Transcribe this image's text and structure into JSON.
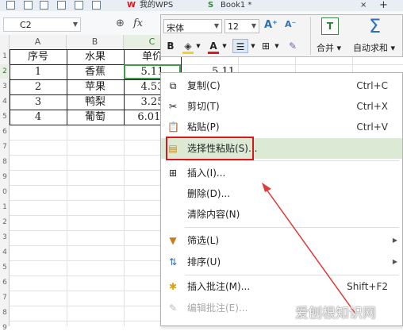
{
  "tabs": {
    "wps": "我的WPS",
    "book": "Book1 *"
  },
  "name_box": {
    "value": "C2"
  },
  "formula": {
    "fx_label": "fx"
  },
  "mini_toolbar": {
    "font": "宋体",
    "size": "12",
    "bold": "B",
    "font_color_letter": "A",
    "merge_label": "合并",
    "autosum_label": "自动求和",
    "merge_icon_letter": "T",
    "sum_symbol": "Σ"
  },
  "columns": [
    "A",
    "B",
    "C"
  ],
  "rows": [
    "1",
    "2",
    "3",
    "4",
    "5",
    "6",
    "7",
    "8",
    "9",
    "0",
    "1",
    "2",
    "3",
    "4",
    "5",
    "6",
    "7",
    "8",
    "9"
  ],
  "table": {
    "headers": [
      "序号",
      "水果",
      "单价"
    ],
    "rows": [
      [
        "1",
        "香蕉",
        "5.11"
      ],
      [
        "2",
        "苹果",
        "4.53"
      ],
      [
        "3",
        "鸭梨",
        "3.25"
      ],
      [
        "4",
        "葡萄",
        "6.012"
      ]
    ],
    "d2_value": "5.11"
  },
  "context_menu": {
    "copy": {
      "label": "复制(C)",
      "shortcut": "Ctrl+C"
    },
    "cut": {
      "label": "剪切(T)",
      "shortcut": "Ctrl+X"
    },
    "paste": {
      "label": "粘贴(P)",
      "shortcut": "Ctrl+V"
    },
    "paste_special": {
      "label": "选择性粘贴(S)..."
    },
    "insert": {
      "label": "插入(I)..."
    },
    "delete": {
      "label": "删除(D)..."
    },
    "clear": {
      "label": "清除内容(N)"
    },
    "filter": {
      "label": "筛选(L)"
    },
    "sort": {
      "label": "排序(U)"
    },
    "insert_comment": {
      "label": "插入批注(M)...",
      "shortcut": "Shift+F2"
    },
    "edit_comment": {
      "label": "编辑批注(E)..."
    }
  },
  "watermark": "爱刨根知识网",
  "colors": {
    "selection": "#3f9a49",
    "highlight": "#d9161c",
    "menu_hover": "#dbe9d5",
    "arrow": "#e03a3a"
  }
}
